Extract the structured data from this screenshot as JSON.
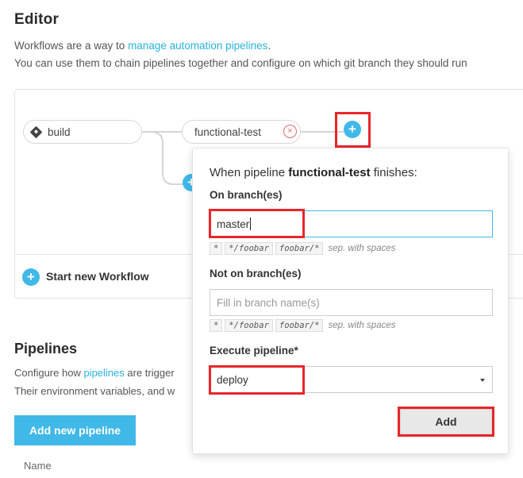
{
  "editor": {
    "title": "Editor",
    "intro_prefix": "Workflows are a way to ",
    "intro_link": "manage automation pipelines",
    "intro_suffix": ".",
    "intro_line2": "You can use them to chain pipelines together and configure on which git branch they should run"
  },
  "workflow": {
    "nodes": [
      {
        "label": "build",
        "icon": "git-icon"
      },
      {
        "label": "functional-test",
        "remove_icon": "close-circle-icon"
      }
    ],
    "add_icon": "+",
    "start_new_label": "Start new Workflow"
  },
  "pipelines": {
    "title": "Pipelines",
    "line1_prefix": "Configure how ",
    "line1_link": "pipelines",
    "line1_suffix": " are trigger",
    "line2": "Their environment variables, and w",
    "add_button_label": "Add new pipeline",
    "name_column": "Name"
  },
  "popover": {
    "title_prefix": "When pipeline ",
    "title_pipeline": "functional-test",
    "title_suffix": " finishes:",
    "on_branch_label": "On branch(es)",
    "on_branch_value": "master",
    "not_on_branch_label": "Not on branch(es)",
    "not_on_branch_placeholder": "Fill in branch name(s)",
    "hint_chips": [
      "*",
      "*/foobar",
      "foobar/*"
    ],
    "hint_sep": "sep. with spaces",
    "execute_label": "Execute pipeline*",
    "execute_value": "deploy",
    "add_button_label": "Add"
  },
  "colors": {
    "accent": "#40b8e8",
    "link": "#2bb1dd",
    "highlight": "#e8262a",
    "remove": "#e06a6a"
  }
}
